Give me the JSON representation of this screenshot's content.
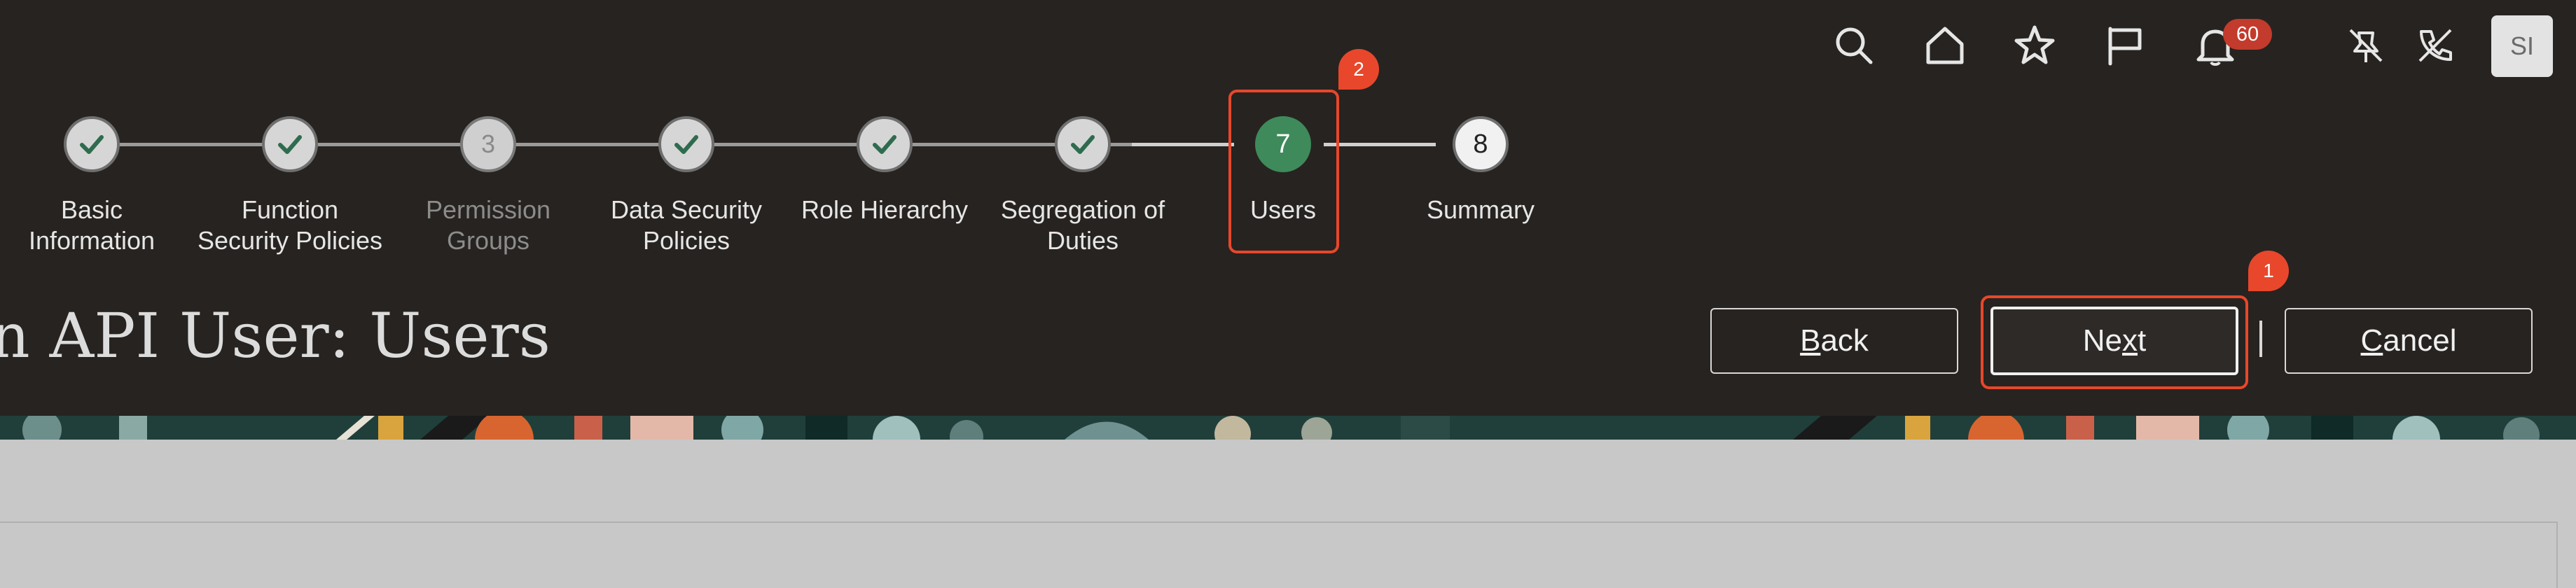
{
  "global_header": {
    "icons": [
      "search-icon",
      "home-icon",
      "star-icon",
      "flag-icon",
      "bell-icon",
      "pin-off-icon",
      "phone-off-icon"
    ],
    "notifications_count": "60",
    "user_initials": "SI"
  },
  "train": {
    "steps": [
      {
        "label_line1": "Basic",
        "label_line2": "Information",
        "state": "done"
      },
      {
        "label_line1": "Function",
        "label_line2": "Security Policies",
        "state": "done"
      },
      {
        "label_line1": "Permission",
        "label_line2": "Groups",
        "state": "disabled",
        "number": "3"
      },
      {
        "label_line1": "Data Security",
        "label_line2": "Policies",
        "state": "done"
      },
      {
        "label_line1": "Role Hierarchy",
        "label_line2": "",
        "state": "done"
      },
      {
        "label_line1": "Segregation of",
        "label_line2": "Duties",
        "state": "done"
      },
      {
        "label_line1": "Users",
        "label_line2": "",
        "state": "current",
        "number": "7"
      },
      {
        "label_line1": "Summary",
        "label_line2": "",
        "state": "upcoming",
        "number": "8"
      }
    ]
  },
  "page_title": "n API User: Users",
  "buttons": {
    "back": {
      "accel": "B",
      "rest": "ack"
    },
    "next": {
      "pre": "Ne",
      "accel": "x",
      "rest": "t"
    },
    "cancel": {
      "accel": "C",
      "rest": "ancel"
    }
  },
  "callouts": {
    "next_badge": "1",
    "users_badge": "2"
  },
  "colors": {
    "accent_callout": "#e8472b",
    "current_step": "#3e8a5a",
    "header_bg": "#272320"
  }
}
